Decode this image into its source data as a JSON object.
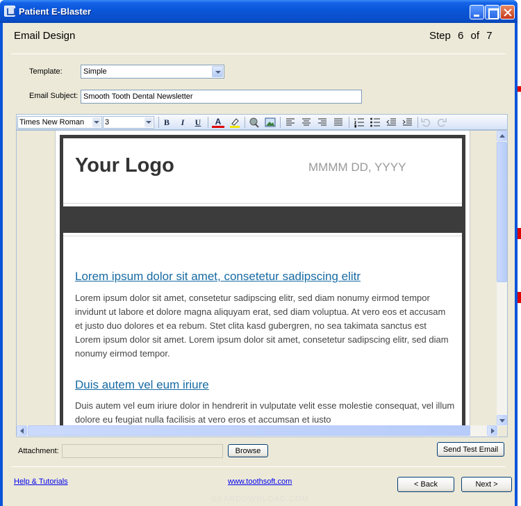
{
  "window": {
    "title": "Patient E-Blaster"
  },
  "header": {
    "title": "Email Design",
    "step_label": "Step",
    "step_current": "6",
    "step_of": "of",
    "step_total": "7"
  },
  "template": {
    "label": "Template:",
    "value": "Simple"
  },
  "subject": {
    "label": "Email Subject:",
    "value": "Smooth Tooth Dental Newsletter"
  },
  "toolbar": {
    "font": "Times New Roman",
    "size": "3",
    "icons": [
      "bold-icon",
      "italic-icon",
      "underline-icon",
      "font-color-icon",
      "highlight-icon",
      "link-icon",
      "image-icon",
      "align-left-icon",
      "align-center-icon",
      "align-right-icon",
      "justify-icon",
      "numbered-list-icon",
      "bullet-list-icon",
      "outdent-icon",
      "indent-icon",
      "undo-icon",
      "redo-icon"
    ],
    "bold": "B",
    "italic": "I",
    "underline": "U",
    "font_color": "A"
  },
  "email": {
    "logo": "Your Logo",
    "date": "MMMM DD, YYYY",
    "heading1": "Lorem ipsum dolor sit amet, consetetur sadipscing elitr",
    "para1": "Lorem ipsum dolor sit amet, consetetur sadipscing elitr, sed diam nonumy eirmod tempor invidunt ut labore et dolore magna aliquyam erat, sed diam voluptua. At vero eos et accusam et justo duo dolores et ea rebum. Stet clita kasd gubergren, no sea takimata sanctus est Lorem ipsum dolor sit amet. Lorem ipsum dolor sit amet, consetetur sadipscing elitr, sed diam nonumy eirmod tempor.",
    "heading2": "Duis autem vel eum iriure",
    "para2": "Duis autem vel eum iriure dolor in hendrerit in vulputate velit esse molestie consequat, vel illum dolore eu feugiat nulla facilisis at vero eros et accumsan et iusto"
  },
  "attachment": {
    "label": "Attachment:",
    "value": "",
    "browse": "Browse"
  },
  "send_test": "Send Test Email",
  "footer": {
    "help": "Help & Tutorials",
    "website": "www.toothsoft.com",
    "back": "< Back",
    "next": "Next >"
  },
  "watermark": "GEARDOWNLOAD.COM",
  "colors": {
    "title_bar": "#0a55d8",
    "client_bg": "#ece9d8",
    "heading_link": "#176aa3",
    "band": "#3c3c3c"
  }
}
